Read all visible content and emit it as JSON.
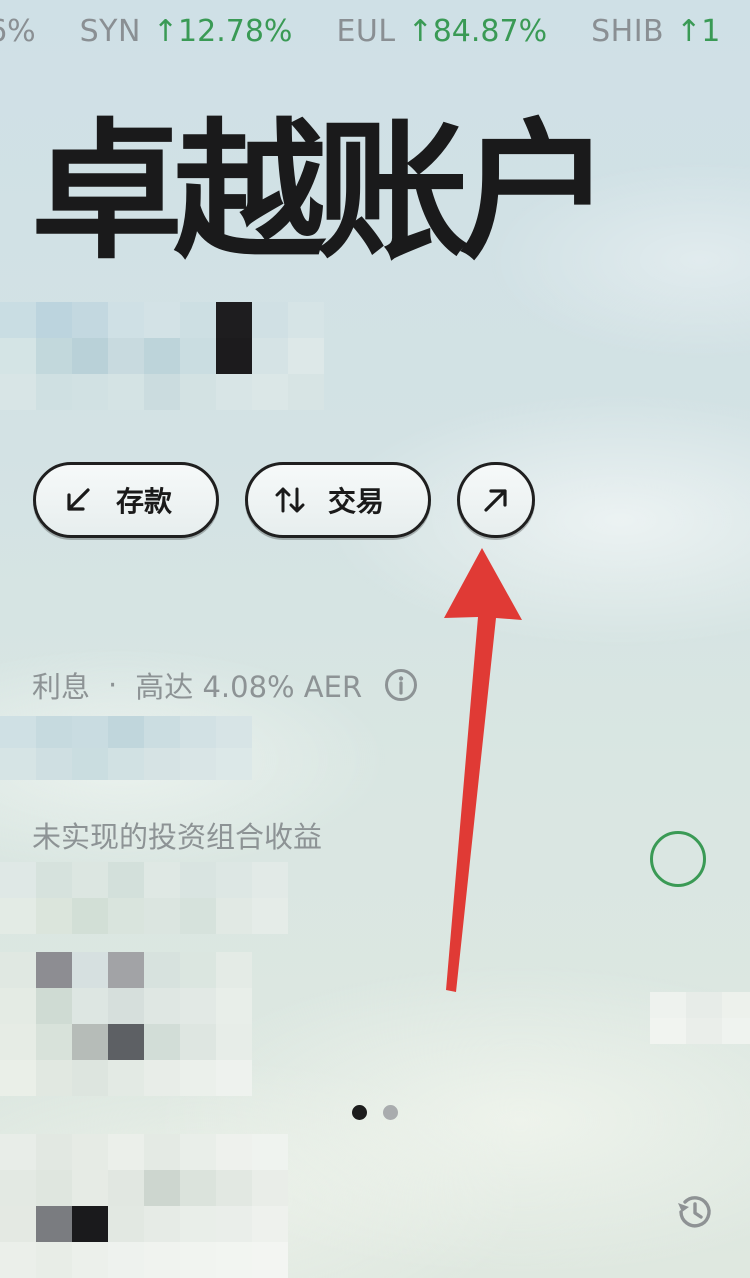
{
  "ticker": [
    {
      "symbol": "",
      "change": "6%"
    },
    {
      "symbol": "SYN",
      "change": "↑12.78%"
    },
    {
      "symbol": "EUL",
      "change": "↑84.87%"
    },
    {
      "symbol": "SHIB",
      "change": "↑1"
    }
  ],
  "header": {
    "title": "卓越账户"
  },
  "actions": {
    "deposit_label": "存款",
    "trade_label": "交易"
  },
  "interest": {
    "label": "利息",
    "separator": "·",
    "rate_text": "高达 4.08% AER"
  },
  "portfolio": {
    "unrealized_label": "未实现的投资组合收益"
  },
  "pager": {
    "count": 2,
    "active": 1
  },
  "icons": {
    "deposit": "arrow-down-left-icon",
    "trade": "swap-vertical-icon",
    "more": "arrow-up-right-icon",
    "info": "info-icon",
    "status": "circle-icon",
    "history": "history-icon"
  },
  "colors": {
    "positive": "#3a9a55",
    "title": "#1a1a1b",
    "annotation": "#e03a35"
  }
}
